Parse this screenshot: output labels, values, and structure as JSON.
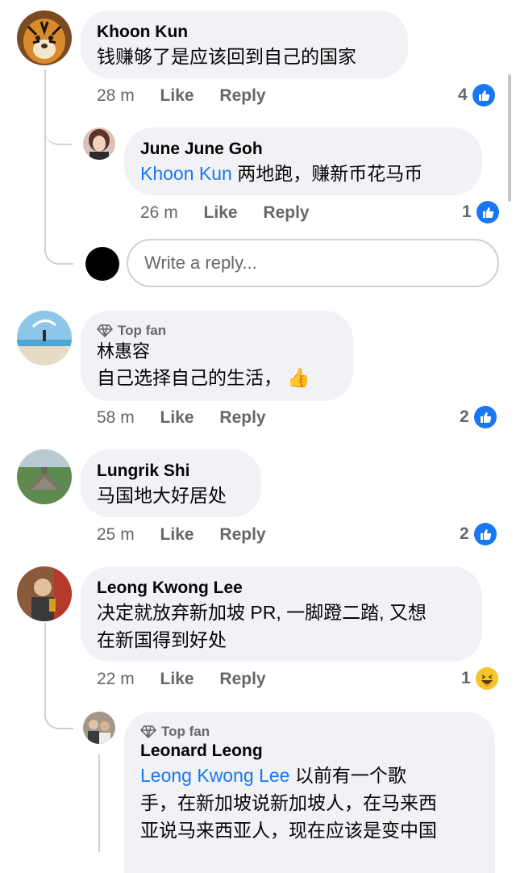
{
  "comments": [
    {
      "author": "Khoon Kun",
      "text": "钱赚够了是应该回到自己的国家",
      "time": "28 m",
      "like": "Like",
      "reply": "Reply",
      "count": "4",
      "reaction": "like-icon"
    },
    {
      "author": "June June Goh",
      "mention": "Khoon Kun",
      "text": " 两地跑，赚新币花马币",
      "time": "26 m",
      "like": "Like",
      "reply": "Reply",
      "count": "1",
      "reaction": "like-icon"
    },
    {
      "badge": "Top fan",
      "author": "林惠容",
      "text": "自己选择自己的生活，",
      "emoji": "👍",
      "time": "58 m",
      "like": "Like",
      "reply": "Reply",
      "count": "2",
      "reaction": "like-icon"
    },
    {
      "author": "Lungrik Shi",
      "text": "马国地大好居处",
      "time": "25 m",
      "like": "Like",
      "reply": "Reply",
      "count": "2",
      "reaction": "like-icon"
    },
    {
      "author": "Leong Kwong Lee",
      "text_line1": "决定就放弃新加坡 PR, 一脚蹬二踏, 又想",
      "text_line2": "在新国得到好处",
      "time": "22 m",
      "like": "Like",
      "reply": "Reply",
      "count": "1",
      "reaction": "haha-icon"
    },
    {
      "badge": "Top fan",
      "author": "Leonard Leong",
      "mention": "Leong Kwong Lee",
      "text_line1": " 以前有一个歌",
      "text_line2": "手，在新加坡说新加坡人，在马来西",
      "text_line3": "亚说马来西亚人，现在应该是变中国"
    }
  ],
  "reply_box": {
    "placeholder": "Write a reply..."
  },
  "colors": {
    "accent": "#1877f2",
    "bubble": "#f0f2f5",
    "muted": "#65676b"
  }
}
